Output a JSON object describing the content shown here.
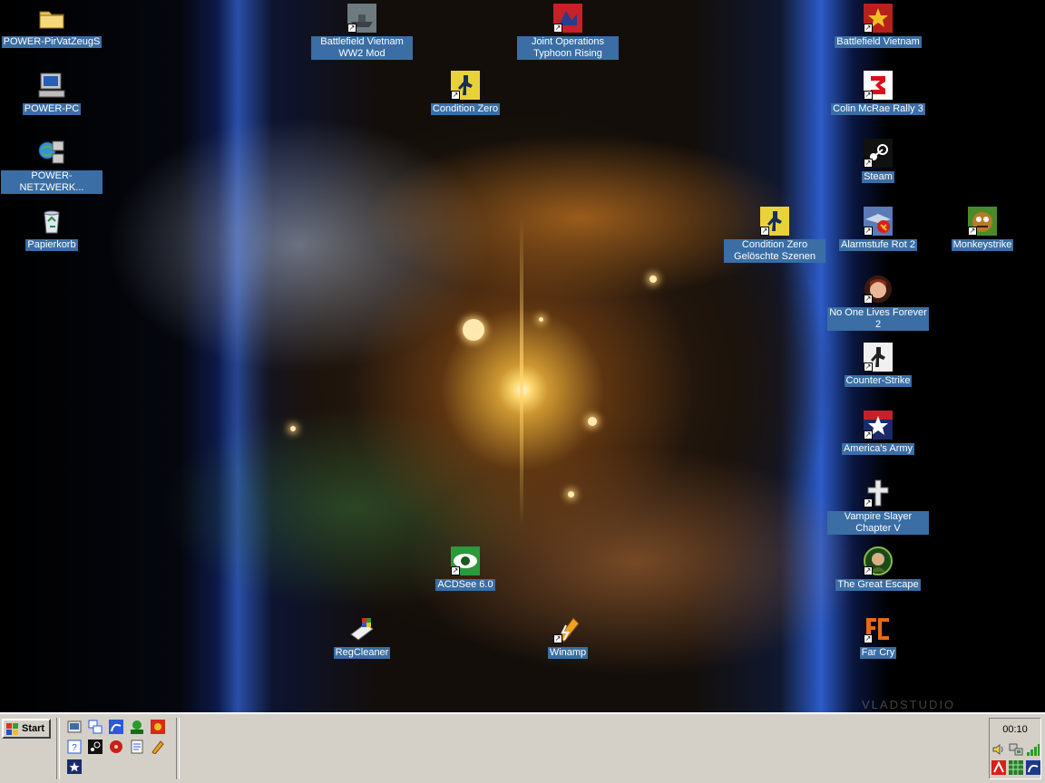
{
  "desktop": {
    "icons": [
      {
        "label": "POWER-PirVatZeugS",
        "icon": "folder-icon"
      },
      {
        "label": "POWER-PC",
        "icon": "computer-icon"
      },
      {
        "label": "POWER-NETZWERK...",
        "icon": "network-icon"
      },
      {
        "label": "Papierkorb",
        "icon": "recycle-bin-icon"
      },
      {
        "label": "Battlefield Vietnam WW2 Mod",
        "icon": "battlefield-ww2-mod-icon"
      },
      {
        "label": "Joint Operations Typhoon Rising",
        "icon": "joint-operations-icon"
      },
      {
        "label": "Battlefield Vietnam",
        "icon": "battlefield-vietnam-icon"
      },
      {
        "label": "Condition Zero",
        "icon": "condition-zero-icon"
      },
      {
        "label": "Colin McRae Rally 3",
        "icon": "colin-mcrae-icon"
      },
      {
        "label": "Steam",
        "icon": "steam-icon"
      },
      {
        "label": "Condition Zero Gelöschte Szenen",
        "icon": "condition-zero-deleted-icon"
      },
      {
        "label": "Alarmstufe Rot 2",
        "icon": "alarmstufe-rot-icon"
      },
      {
        "label": "Monkeystrike",
        "icon": "monkeystrike-icon"
      },
      {
        "label": "No One Lives Forever 2",
        "icon": "nolf2-icon"
      },
      {
        "label": "Counter-Strike",
        "icon": "counter-strike-icon"
      },
      {
        "label": "America's Army",
        "icon": "americas-army-icon"
      },
      {
        "label": "Vampire Slayer Chapter V",
        "icon": "vampire-slayer-icon"
      },
      {
        "label": "The Great Escape",
        "icon": "great-escape-icon"
      },
      {
        "label": "ACDSee 6.0",
        "icon": "acdsee-icon"
      },
      {
        "label": "RegCleaner",
        "icon": "regcleaner-icon"
      },
      {
        "label": "Winamp",
        "icon": "winamp-icon"
      },
      {
        "label": "Far Cry",
        "icon": "far-cry-icon"
      }
    ]
  },
  "taskbar": {
    "start_label": "Start",
    "quick_launch": [
      "show-desktop-icon",
      "switch-windows-icon",
      "ie-shortcut-icon",
      "pro-app-icon",
      "game-icon",
      "help-icon",
      "steam-icon",
      "red-disc-icon",
      "notepad-icon",
      "winamp-icon",
      "americas-army-icon"
    ],
    "tray": {
      "clock": "00:10",
      "icons": [
        "volume-icon",
        "network-tray-icon",
        "signal-icon",
        "antivirus-icon",
        "grid-icon",
        "ie-tray-icon"
      ]
    }
  },
  "wallpaper_watermark": "VLADSTUDIO",
  "colors": {
    "label_bg": "#3a6ea5",
    "taskbar": "#d4d0c8",
    "text": "#ffffff"
  }
}
